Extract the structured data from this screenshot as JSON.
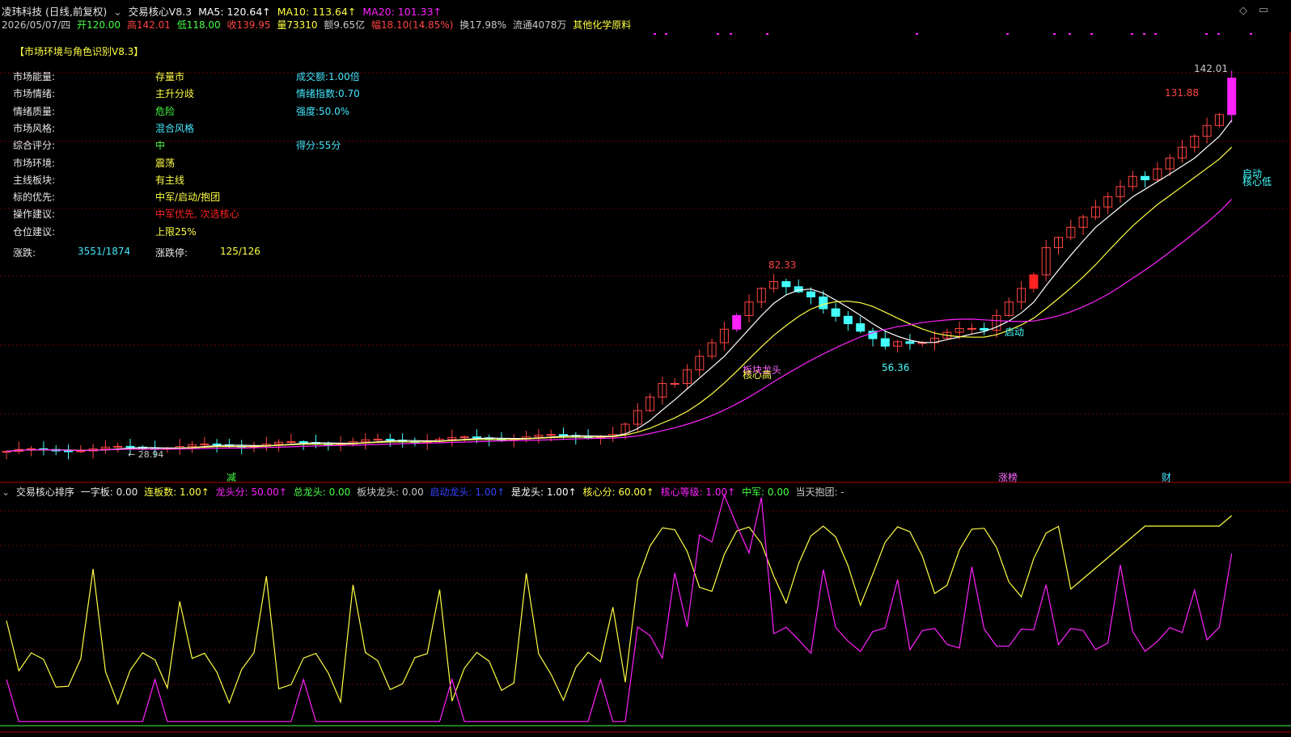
{
  "header": {
    "stock_name": "凌玮科技 (日线,前复权)",
    "indicator_name": "交易核心V8.3",
    "ma5": "MA5: 120.64↑",
    "ma10": "MA10: 113.64↑",
    "ma20": "MA20: 101.33↑",
    "date": "2026/05/07/四",
    "open": "开120.00",
    "high": "高142.01",
    "low": "低118.00",
    "close": "收139.95",
    "volume": "量73310",
    "amount": "额9.65亿",
    "change": "幅18.10(14.85%)",
    "turnover": "换17.98%",
    "float": "流通4078万",
    "sector": "其他化学原料"
  },
  "panel": {
    "title": "【市场环境与角色识别V8.3】",
    "rows": [
      {
        "label": "市场能量:",
        "value": "存量市",
        "value_color": "#ffff44",
        "extra": "成交额:1.00倍",
        "extra_color": "#44e8ff"
      },
      {
        "label": "市场情绪:",
        "value": "主升分歧",
        "value_color": "#ffff44",
        "extra": "情绪指数:0.70",
        "extra_color": "#44e8ff"
      },
      {
        "label": "情绪质量:",
        "value": "危险",
        "value_color": "#44ff44",
        "extra": "强度:50.0%",
        "extra_color": "#44e8ff"
      },
      {
        "label": "市场风格:",
        "value": "混合风格",
        "value_color": "#44e8ff",
        "extra": "",
        "extra_color": "#44e8ff"
      },
      {
        "label": "综合评分:",
        "value": "中",
        "value_color": "#44ff44",
        "extra": "得分:55分",
        "extra_color": "#44e8ff"
      },
      {
        "label": "市场环境:",
        "value": "震荡",
        "value_color": "#ffff44",
        "extra": "",
        "extra_color": "#44e8ff"
      },
      {
        "label": "主线板块:",
        "value": "有主线",
        "value_color": "#ffff44",
        "extra": "",
        "extra_color": "#44e8ff"
      },
      {
        "label": "标的优先:",
        "value": "中军/启动/抱团",
        "value_color": "#ffff44",
        "extra": "",
        "extra_color": "#44e8ff"
      },
      {
        "label": "操作建议:",
        "value": "中军优先, 次选核心",
        "value_color": "#ff2222",
        "extra": "",
        "extra_color": "#44e8ff"
      },
      {
        "label": "仓位建议:",
        "value": "上限25%",
        "value_color": "#ffff44",
        "extra": "",
        "extra_color": "#44e8ff"
      }
    ],
    "rise_fall_label": "涨跌:",
    "rise_fall_value": "3551/1874",
    "limit_label": "涨跌停:",
    "limit_value": "125/126"
  },
  "chart_annotations": {
    "high_label": "142.01",
    "peak1": "131.88",
    "peak2": "82.33",
    "low1": "56.36",
    "low_start": "28.94",
    "start_label_right": "启动",
    "core_low_right": "核心低",
    "start_label_mid": "启动",
    "core_high": "核心高",
    "sector_leader": "板块龙头",
    "bottom_tag1": "减",
    "bottom_tag2": "涨榜",
    "bottom_tag3": "财"
  },
  "sub_header": {
    "name": "交易核心排序",
    "yizi": "一字板: 0.00",
    "lianban": "连板数: 1.00↑",
    "longtou_score": "龙头分: 50.00↑",
    "zong_longtou": "总龙头: 0.00",
    "bankuai_longtou": "板块龙头: 0.00",
    "qidong_longtou": "启动龙头: 1.00↑",
    "shi_longtou": "是龙头: 1.00↑",
    "hexin_score": "核心分: 60.00↑",
    "hexin_level": "核心等级: 1.00↑",
    "zhongjun": "中军: 0.00",
    "baotuan": "当天抱团: -"
  },
  "colors": {
    "up": "#ff4444",
    "down": "#44ffff",
    "ma5": "#ffffff",
    "ma10": "#ffff44",
    "ma20": "#ff22ff",
    "grid": "#6e0000"
  },
  "icons": [
    "chevron-circle-icon",
    "diamond-icon",
    "window-icon"
  ]
}
